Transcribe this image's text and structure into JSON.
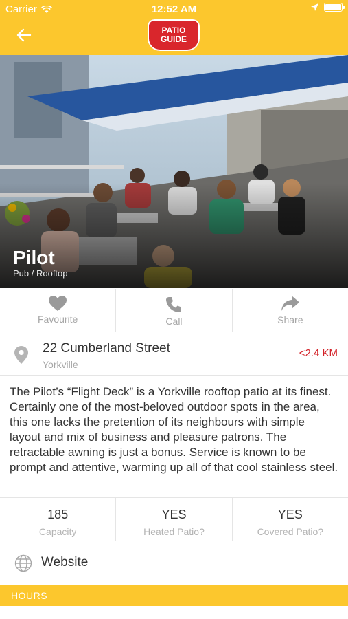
{
  "status_bar": {
    "carrier": "Carrier",
    "time": "12:52 AM"
  },
  "nav": {
    "logo_line1": "PATIO",
    "logo_line2": "GUIDE",
    "brand_color": "#fcc72d",
    "logo_color": "#d9262c"
  },
  "venue": {
    "name": "Pilot",
    "category": "Pub / Rooftop"
  },
  "actions": [
    {
      "label": "Favourite",
      "icon": "heart-icon"
    },
    {
      "label": "Call",
      "icon": "phone-icon"
    },
    {
      "label": "Share",
      "icon": "share-arrow-icon"
    }
  ],
  "address": {
    "street": "22 Cumberland Street",
    "neighbourhood": "Yorkville",
    "distance": "<2.4 KM",
    "distance_color": "#d32027"
  },
  "description": "The Pilot’s “Flight Deck” is a Yorkville rooftop patio at its finest. Certainly one of the most-beloved outdoor spots in the area, this one lacks the pretention of its neighbours with simple layout and mix of business and pleasure patrons. The retractable awning is just a bonus. Service is known to be prompt and attentive, warming up all of that cool stainless steel.",
  "stats": [
    {
      "value": "185",
      "label": "Capacity"
    },
    {
      "value": "YES",
      "label": "Heated Patio?"
    },
    {
      "value": "YES",
      "label": "Covered Patio?"
    }
  ],
  "website": {
    "label": "Website"
  },
  "hours": {
    "label": "HOURS"
  }
}
